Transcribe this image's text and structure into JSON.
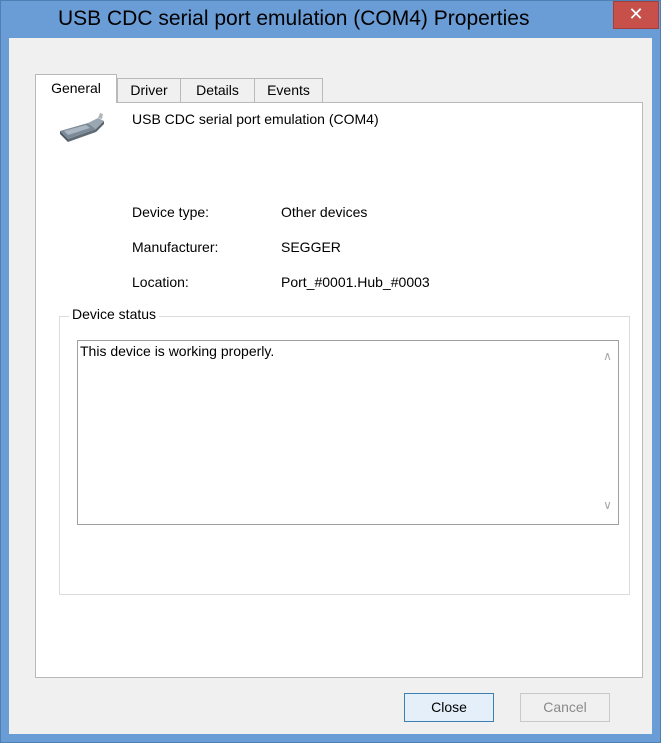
{
  "window": {
    "title": "USB CDC serial port emulation (COM4) Properties",
    "close_glyph": "✕",
    "title_bar_color": "#6a9cd6",
    "close_button_color": "#c7504b"
  },
  "tabs": [
    {
      "label": "General",
      "active": true
    },
    {
      "label": "Driver",
      "active": false
    },
    {
      "label": "Details",
      "active": false
    },
    {
      "label": "Events",
      "active": false
    }
  ],
  "general": {
    "device_icon": "usb-serial-device-icon",
    "device_name": "USB CDC serial port emulation (COM4)",
    "properties": [
      {
        "label": "Device type:",
        "value": "Other devices"
      },
      {
        "label": "Manufacturer:",
        "value": "SEGGER"
      },
      {
        "label": "Location:",
        "value": "Port_#0001.Hub_#0003"
      }
    ],
    "status_group_label": "Device status",
    "status_text": "This device is working properly.",
    "scroll_up_glyph": "∧",
    "scroll_down_glyph": "∨"
  },
  "buttons": {
    "close": "Close",
    "cancel": "Cancel"
  }
}
